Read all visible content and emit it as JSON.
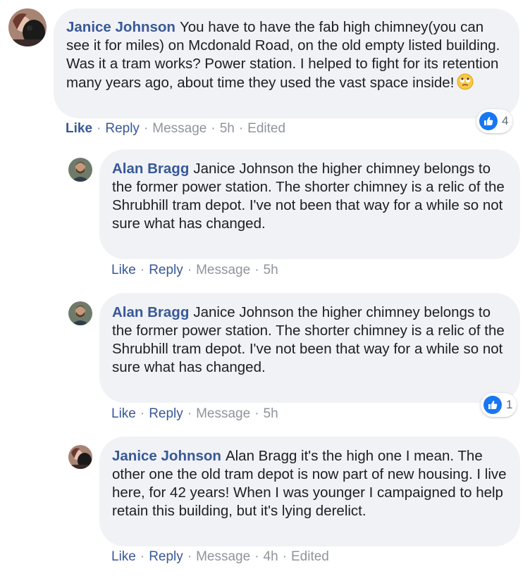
{
  "comments": [
    {
      "author": "Janice Johnson",
      "text": "You have to have the fab high chimney(you can see it for miles) on Mcdonald Road, on the old empty listed building. Was it a tram works? Power station. I helped to fight for its retention many years ago, about time they used the vast space inside!",
      "emoji": "face-with-rolling-eyes-icon",
      "actions": {
        "like": "Like",
        "reply": "Reply",
        "message": "Message",
        "time": "5h",
        "edited": "Edited"
      },
      "reactions": {
        "type": "like",
        "count": "4"
      }
    },
    {
      "author": "Alan Bragg",
      "text": "Janice Johnson the higher chimney belongs to the former power station. The shorter chimney is a relic of the Shrubhill tram depot. I've not been that way for a while so not sure what has changed.",
      "actions": {
        "like": "Like",
        "reply": "Reply",
        "message": "Message",
        "time": "5h"
      }
    },
    {
      "author": "Alan Bragg",
      "text": "Janice Johnson the higher chimney belongs to the former power station. The shorter chimney is a relic of the Shrubhill tram depot. I've not been that way for a while so not sure what has changed.",
      "actions": {
        "like": "Like",
        "reply": "Reply",
        "message": "Message",
        "time": "5h"
      },
      "reactions": {
        "type": "like",
        "count": "1"
      }
    },
    {
      "author": "Janice Johnson",
      "text": "Alan Bragg it's the high one I mean. The other one the old tram depot is now part of new housing. I live here, for 42 years! When I was younger I campaigned to help retain this building, but it's lying derelict.",
      "actions": {
        "like": "Like",
        "reply": "Reply",
        "message": "Message",
        "time": "4h",
        "edited": "Edited"
      }
    }
  ],
  "separator": "·",
  "colors": {
    "link": "#385898",
    "bubble": "#f0f2f5",
    "meta": "#90949c",
    "like_blue": "#1877f2"
  }
}
